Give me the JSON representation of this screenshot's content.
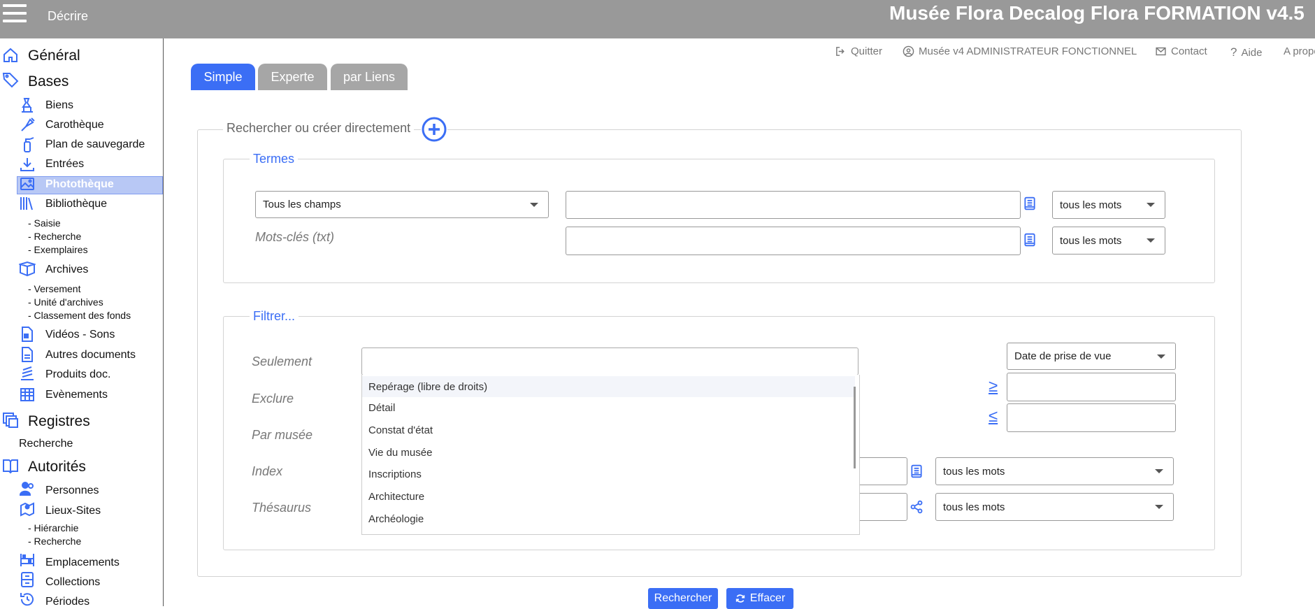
{
  "topbar": {
    "menu_label": "Décrire",
    "app_title": "Musée Flora Decalog Flora FORMATION v4.5"
  },
  "sidebar": {
    "general": "Général",
    "bases": "Bases",
    "biens": "Biens",
    "carotheque": "Carothèque",
    "plan_sauvegarde": "Plan de sauvegarde",
    "entrees": "Entrées",
    "phototheque": "Photothèque",
    "bibliotheque": "Bibliothèque",
    "bib_saisie": "- Saisie",
    "bib_recherche": "- Recherche",
    "bib_exemplaires": "- Exemplaires",
    "archives": "Archives",
    "arch_versement": "- Versement",
    "arch_unite": "- Unité d'archives",
    "arch_classement": "- Classement des fonds",
    "videos": "Vidéos - Sons",
    "autres_docs": "Autres documents",
    "produits_doc": "Produits doc.",
    "evenements": "Evènements",
    "registres": "Registres",
    "reg_recherche": "Recherche",
    "autorites": "Autorités",
    "personnes": "Personnes",
    "lieux_sites": "Lieux-Sites",
    "lieux_hierarchie": "- Hiérarchie",
    "lieux_recherche": "- Recherche",
    "emplacements": "Emplacements",
    "collections": "Collections",
    "periodes": "Périodes"
  },
  "toplinks": {
    "quitter": "Quitter",
    "user": "Musée v4 ADMINISTRATEUR FONCTIONNEL",
    "contact": "Contact",
    "aide": "Aide",
    "apropos": "A propos"
  },
  "tabs": {
    "simple": "Simple",
    "experte": "Experte",
    "par_liens": "par Liens"
  },
  "colors": {
    "accent": "#3b6ef5",
    "tab_inactive": "#a6a6a6",
    "sidebar_active": "#b8c8f5"
  },
  "search": {
    "legend": "Rechercher ou créer directement",
    "termes": {
      "legend": "Termes",
      "field_select": "Tous les champs",
      "match_select_1": "tous les mots",
      "keywords_label": "Mots-clés (txt)",
      "match_select_2": "tous les mots"
    },
    "filtrer": {
      "legend": "Filtrer...",
      "seulement": "Seulement",
      "exclure": "Exclure",
      "par_musee": "Par musée",
      "index": "Index",
      "thesaurus": "Thésaurus",
      "date_select": "Date de prise de vue",
      "ge_symbol": "≥",
      "le_symbol": "≤",
      "index_match": "tous les mots",
      "thesaurus_match": "tous les mots",
      "dropdown_options": [
        "Repérage (libre de droits)",
        "Détail",
        "Constat d'état",
        "Vie du musée",
        "Inscriptions",
        "Architecture",
        "Archéologie"
      ]
    }
  },
  "buttons": {
    "rechercher": "Rechercher",
    "effacer": "Effacer"
  }
}
